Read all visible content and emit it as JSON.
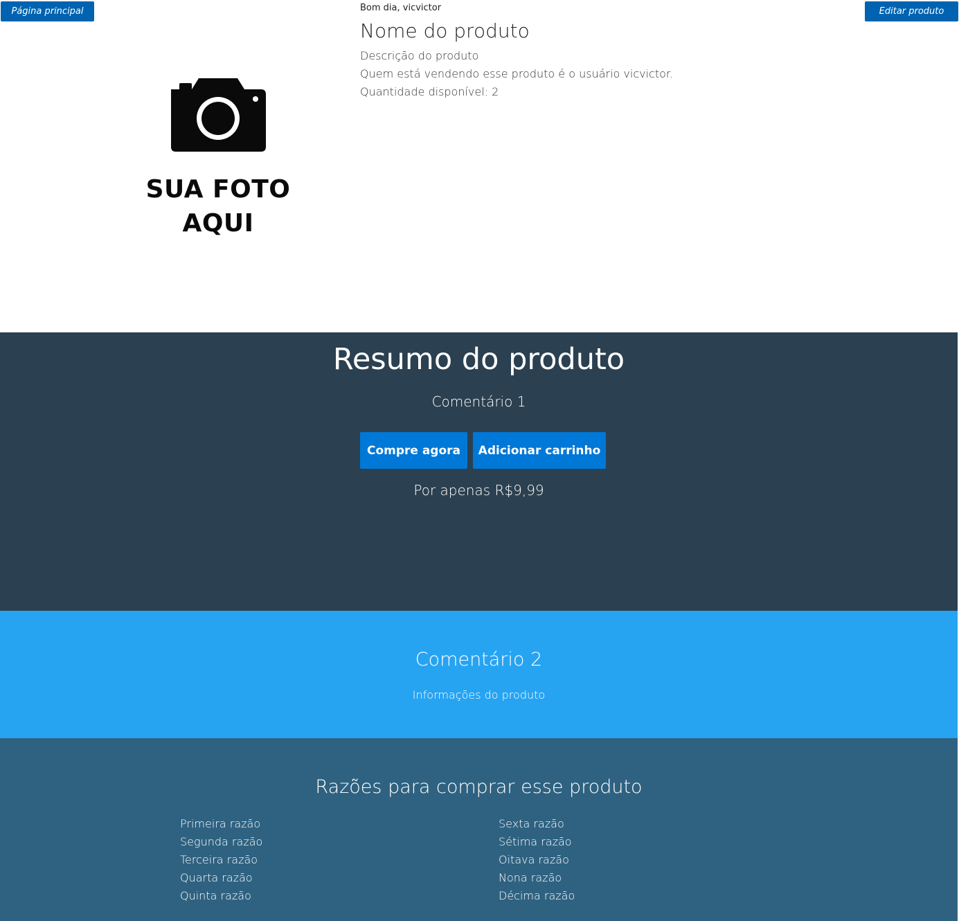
{
  "nav": {
    "home_label": "Página principal",
    "edit_label": "Editar produto"
  },
  "photo": {
    "line1": "SUA FOTO",
    "line2": "AQUI",
    "icon": "camera-icon"
  },
  "product": {
    "greeting": "Bom dia, vicvictor",
    "name": "Nome do produto",
    "description": "Descrição do produto",
    "seller": "Quem está vendendo esse produto é o usuário vicvictor.",
    "quantity": "Quantidade disponível: 2"
  },
  "summary": {
    "title": "Resumo do produto",
    "comment": "Comentário 1",
    "buy_label": "Compre agora",
    "cart_label": "Adicionar carrinho",
    "price": "Por apenas R$9,99"
  },
  "comment2": {
    "title": "Comentário 2",
    "info": "Informações do produto"
  },
  "reasons": {
    "title": "Razões para comprar esse produto",
    "left": [
      "Primeira razão",
      "Segunda razão",
      "Terceira razão",
      "Quarta razão",
      "Quinta razão"
    ],
    "right": [
      "Sexta razão",
      "Sétima razão",
      "Oitava razão",
      "Nona razão",
      "Décima razão"
    ]
  },
  "colors": {
    "button_small": "#0063b1",
    "button_big": "#0078d7",
    "summary_bg": "#2b4050",
    "comment_bg": "#26a4f2",
    "reasons_bg": "#2f6281"
  }
}
